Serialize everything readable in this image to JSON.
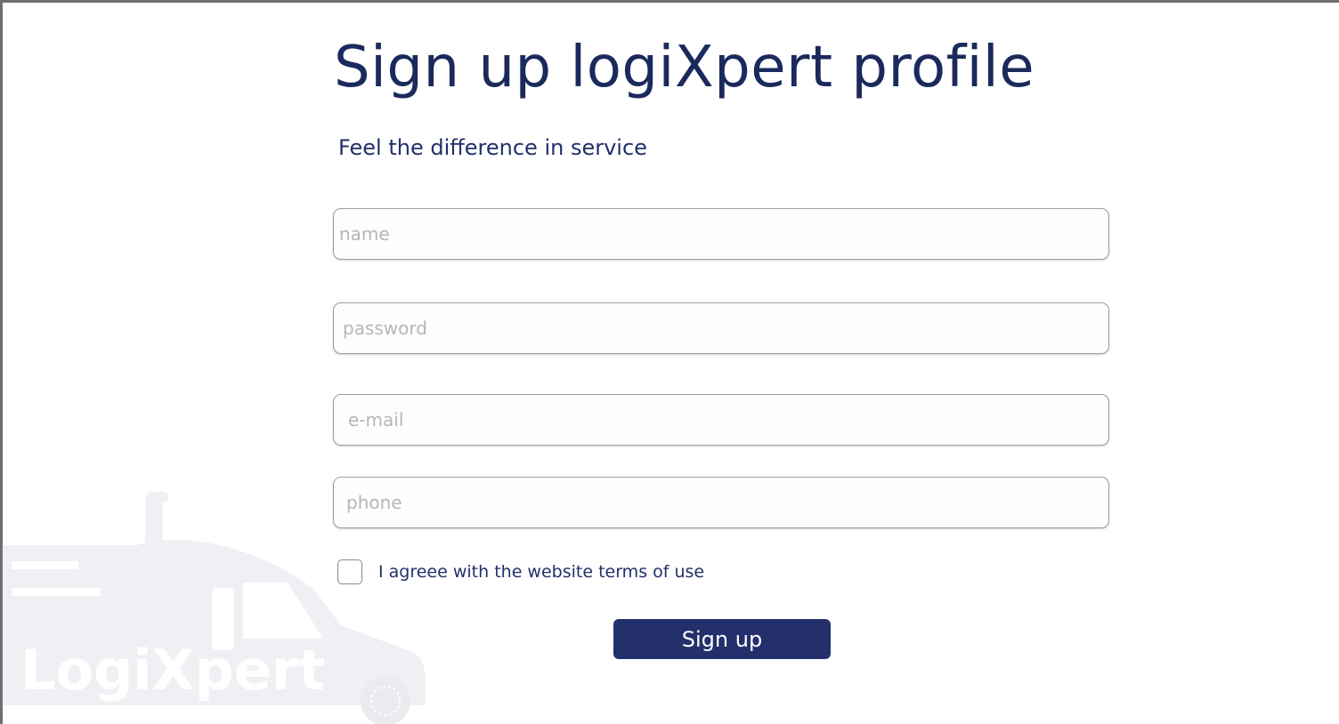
{
  "header": {
    "title": "Sign up logiXpert profile",
    "subtitle": "Feel the difference in service"
  },
  "form": {
    "name_placeholder": "name",
    "password_placeholder": "password",
    "email_placeholder": "e-mail",
    "phone_placeholder": "phone",
    "terms_label": "I agreee with the website terms of use",
    "terms_checked": false,
    "submit_label": "Sign up"
  },
  "watermark": {
    "logo_text": "LogiXpert",
    "icon": "truck-logo-watermark"
  },
  "colors": {
    "primary": "#24306b",
    "heading": "#1b2a5c",
    "placeholder": "#b6b6b6",
    "field_border": "#9e9e9e",
    "watermark": "#eef0f3"
  }
}
